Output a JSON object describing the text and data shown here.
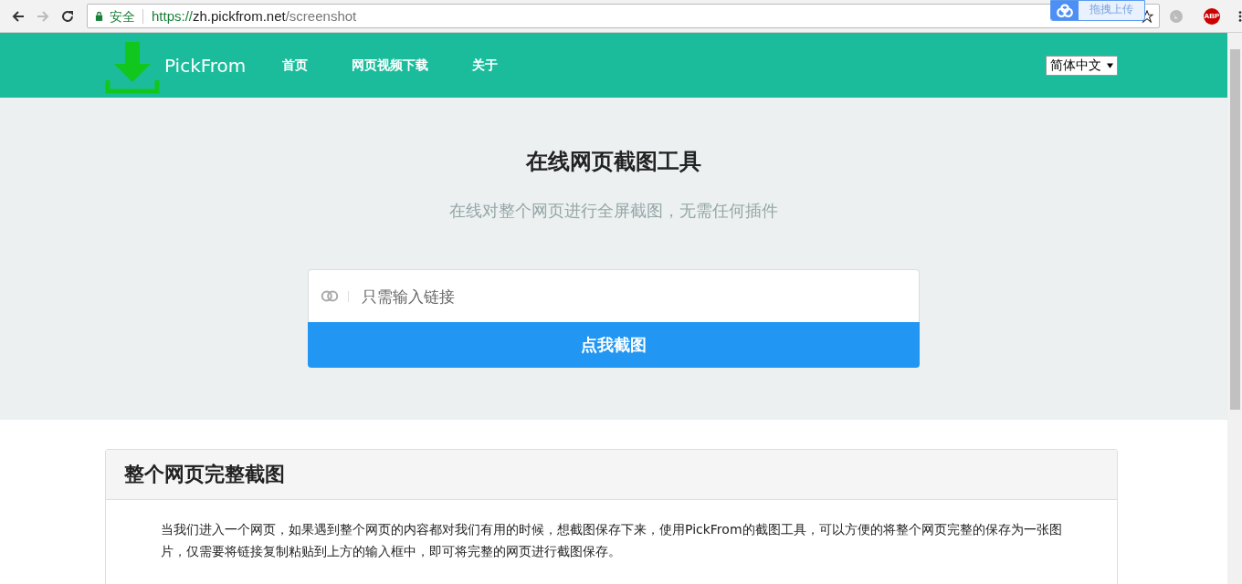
{
  "browser": {
    "security_label": "安全",
    "url_scheme": "https://",
    "url_host": "zh.pickfrom.net",
    "url_path": "/screenshot",
    "extension_tooltip": "拖拽上传",
    "abp_badge": "ABP"
  },
  "header": {
    "brand": "PickFrom",
    "nav": [
      {
        "label": "首页"
      },
      {
        "label": "网页视频下载"
      },
      {
        "label": "关于"
      }
    ],
    "language": "简体中文"
  },
  "hero": {
    "title": "在线网页截图工具",
    "subtitle": "在线对整个网页进行全屏截图，无需任何插件",
    "input": {
      "placeholder": "只需输入链接"
    },
    "button": "点我截图"
  },
  "section": {
    "title": "整个网页完整截图",
    "paragraph": "当我们进入一个网页，如果遇到整个网页的内容都对我们有用的时候，想截图保存下来，使用PickFrom的截图工具，可以方便的将整个网页完整的保存为一张图片，仅需要将链接复制粘贴到上方的输入框中，即可将完整的网页进行截图保存。"
  }
}
